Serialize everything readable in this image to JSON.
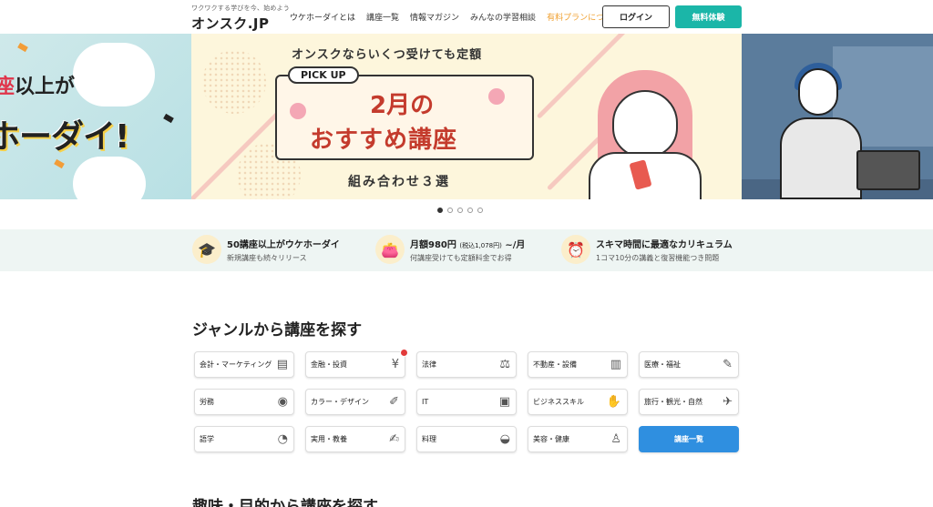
{
  "header": {
    "tagline": "ワクワクする学びを今、始めよう",
    "logo": "オンスク.JP",
    "nav": [
      {
        "label": "ウケホーダイとは"
      },
      {
        "label": "講座一覧"
      },
      {
        "label": "情報マガジン"
      },
      {
        "label": "みんなの学習相談"
      },
      {
        "label": "有料プランについて"
      }
    ],
    "login_label": "ログイン",
    "trial_label": "無料体験"
  },
  "hero": {
    "left_line1_prefix": "座",
    "left_line1_rest": "以上が",
    "left_line2": "ホーダイ!",
    "main_top": "オンスクならいくつ受けても定額",
    "main_pick": "PICK UP",
    "main_title1": "2月の",
    "main_title2": "おすすめ講座",
    "main_sub": "組み合わせ３選"
  },
  "carousel": {
    "count": 5,
    "active": 0
  },
  "features": [
    {
      "icon": "mortarboard-icon",
      "glyph": "🎓",
      "title": "50講座以上がウケホーダイ",
      "sub": "新規講座も続々リリース"
    },
    {
      "icon": "coin-purse-icon",
      "glyph": "👛",
      "title_main": "月額980円",
      "title_small": "(税込1,078円)",
      "title_end": "~/月",
      "sub": "何講座受けても定額料金でお得"
    },
    {
      "icon": "alarm-clock-icon",
      "glyph": "⏰",
      "title": "スキマ時間に最適なカリキュラム",
      "sub": "1コマ10分の講義と復習機能つき問題"
    }
  ],
  "genre_section": {
    "title": "ジャンルから講座を探す",
    "items": [
      {
        "label": "会計・マーケティング",
        "icon": "ledger-icon",
        "glyph": "▤"
      },
      {
        "label": "金融・投資",
        "icon": "yen-coin-icon",
        "glyph": "¥",
        "badge": true
      },
      {
        "label": "法律",
        "icon": "scales-icon",
        "glyph": "⚖"
      },
      {
        "label": "不動産・設備",
        "icon": "building-icon",
        "glyph": "▥"
      },
      {
        "label": "医療・福祉",
        "icon": "syringe-icon",
        "glyph": "✎"
      },
      {
        "label": "労務",
        "icon": "badge-icon",
        "glyph": "◉"
      },
      {
        "label": "カラー・デザイン",
        "icon": "brush-icon",
        "glyph": "✐"
      },
      {
        "label": "IT",
        "icon": "monitor-icon",
        "glyph": "▣"
      },
      {
        "label": "ビジネススキル",
        "icon": "handshake-icon",
        "glyph": "✋"
      },
      {
        "label": "旅行・観光・自然",
        "icon": "airplane-icon",
        "glyph": "✈"
      },
      {
        "label": "語学",
        "icon": "speech-bubble-icon",
        "glyph": "◔"
      },
      {
        "label": "実用・教養",
        "icon": "book-pen-icon",
        "glyph": "✍"
      },
      {
        "label": "料理",
        "icon": "pot-icon",
        "glyph": "◒"
      },
      {
        "label": "美容・健康",
        "icon": "person-icon",
        "glyph": "♙"
      }
    ],
    "all_label": "講座一覧"
  },
  "next_section": {
    "title": "趣味・目的から講座を探す"
  }
}
